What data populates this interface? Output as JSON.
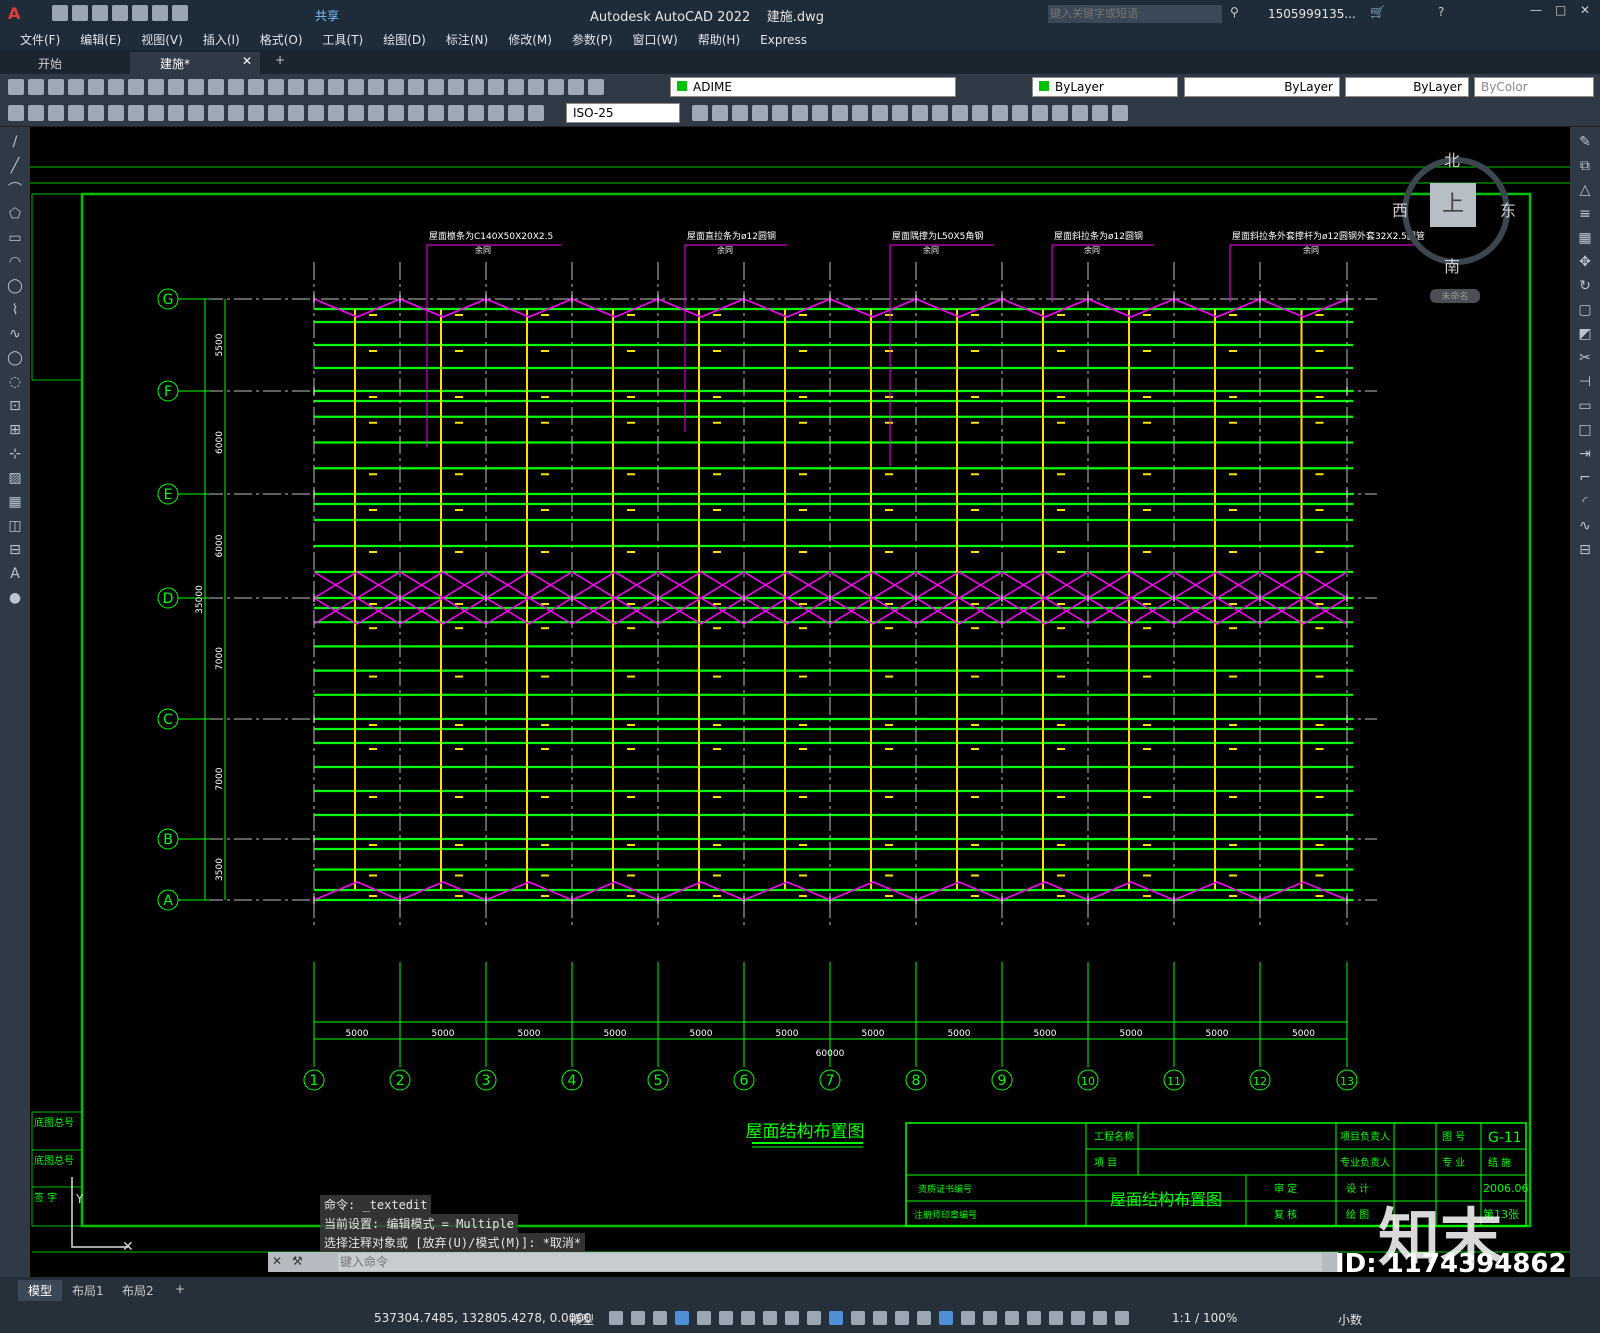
{
  "app": {
    "title": "Autodesk AutoCAD 2022",
    "filename": "建施.dwg",
    "search_placeholder": "键入关键字或短语",
    "user": "1505999135...",
    "share_label": "共享"
  },
  "menu": [
    "文件(F)",
    "编辑(E)",
    "视图(V)",
    "插入(I)",
    "格式(O)",
    "工具(T)",
    "绘图(D)",
    "标注(N)",
    "修改(M)",
    "参数(P)",
    "窗口(W)",
    "帮助(H)",
    "Express"
  ],
  "tabs": [
    {
      "label": "开始"
    },
    {
      "label": "建施*"
    }
  ],
  "toolbar": {
    "layer": "ADIME",
    "color": "ByLayer",
    "linetype": "ByLayer",
    "lineweight": "ByLayer",
    "plotstyle": "ByColor",
    "dimstyle": "ISO-25"
  },
  "viewcube": {
    "north": "北",
    "south": "南",
    "east": "东",
    "west": "西",
    "top": "上",
    "wcs": "未命名"
  },
  "drawing": {
    "callouts": [
      "屋面檩条为C140X50X20X2.5",
      "屋面直拉条为ø12圆钢",
      "屋面隅撑为L50X5角钢",
      "屋面斜拉条为ø12圆钢",
      "屋面斜拉条外套撑杆为ø12圆钢外套32X2.5圆管"
    ],
    "callout_sub": "余同",
    "row_axes": [
      "G",
      "F",
      "E",
      "D",
      "C",
      "B",
      "A"
    ],
    "col_axes": [
      "1",
      "2",
      "3",
      "4",
      "5",
      "6",
      "7",
      "8",
      "9",
      "10",
      "11",
      "12",
      "13"
    ],
    "row_dims": [
      "5500",
      "6000",
      "6000",
      "7000",
      "7000",
      "3500"
    ],
    "row_total": "35000",
    "col_dims": [
      "5000",
      "5000",
      "5000",
      "5000",
      "5000",
      "5000",
      "5000",
      "5000",
      "5000",
      "5000",
      "5000",
      "5000"
    ],
    "col_total": "60000",
    "plan_title": "屋面结构布置图",
    "left_labels": [
      "底图总号",
      "底图总号",
      "签 字"
    ]
  },
  "titleblock": {
    "project_name": "工程名称",
    "item": "项 目",
    "cert": "资质证书编号",
    "reg": "注册师印章编号",
    "drawing_title": "屋面结构布置图",
    "review": "审 定",
    "check": "复 核",
    "proj_lead": "项目负责人",
    "prof_lead": "专业负责人",
    "design": "设 计",
    "draw": "绘 图",
    "sheet_no_label": "图 号",
    "sheet_no": "G-11",
    "discipline_label": "专 业",
    "discipline": "结 施",
    "date": "2006.06",
    "sheet": "第13张"
  },
  "command": {
    "history": [
      "命令: _textedit",
      "当前设置: 编辑模式 = Multiple",
      "选择注释对象或 [放弃(U)/模式(M)]: *取消*"
    ],
    "placeholder": "键入命令"
  },
  "layouts": [
    "模型",
    "布局1",
    "布局2"
  ],
  "status": {
    "coords": "537304.7485, 132805.4278, 0.0000",
    "space": "模型",
    "scale": "1:1 / 100%",
    "units": "小数"
  },
  "watermark": {
    "brand": "知末",
    "id": "ID: 1174394862"
  }
}
